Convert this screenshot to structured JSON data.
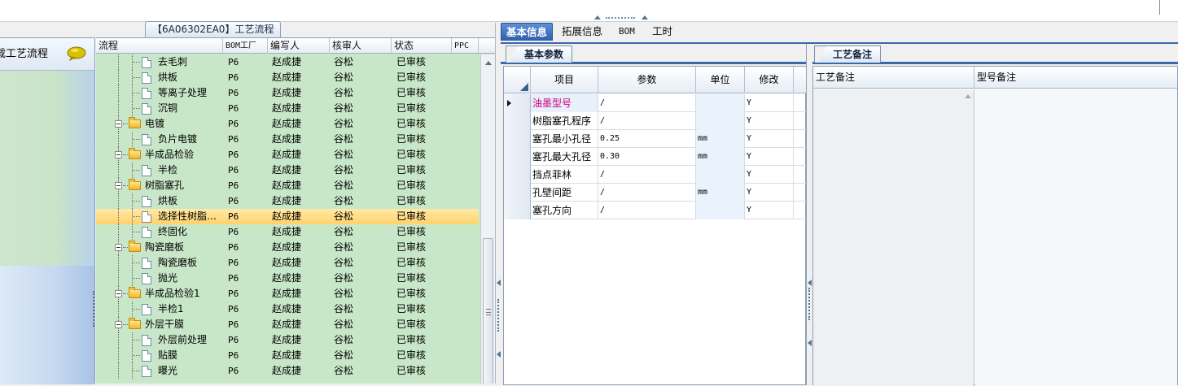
{
  "process_tab_label": "【6A06302EA0】工艺流程",
  "left_panel": {
    "load_label": "载工艺流程"
  },
  "tree": {
    "columns": [
      "流程",
      "BOM工厂",
      "编写人",
      "核审人",
      "状态",
      "PPC"
    ],
    "rows": [
      {
        "type": "leaf",
        "depth": 1,
        "name": "去毛刺",
        "bom": "P6",
        "writer": "赵成捷",
        "auditor": "谷松",
        "status": "已审核"
      },
      {
        "type": "leaf",
        "depth": 1,
        "name": "烘板",
        "bom": "P6",
        "writer": "赵成捷",
        "auditor": "谷松",
        "status": "已审核"
      },
      {
        "type": "leaf",
        "depth": 1,
        "name": "等离子处理",
        "bom": "P6",
        "writer": "赵成捷",
        "auditor": "谷松",
        "status": "已审核"
      },
      {
        "type": "leaf",
        "depth": 1,
        "name": "沉铜",
        "bom": "P6",
        "writer": "赵成捷",
        "auditor": "谷松",
        "status": "已审核"
      },
      {
        "type": "folder",
        "depth": 0,
        "name": "电镀",
        "bom": "P6",
        "writer": "赵成捷",
        "auditor": "谷松",
        "status": "已审核"
      },
      {
        "type": "leaf",
        "depth": 1,
        "name": "负片电镀",
        "bom": "P6",
        "writer": "赵成捷",
        "auditor": "谷松",
        "status": "已审核"
      },
      {
        "type": "folder",
        "depth": 0,
        "name": "半成品检验",
        "bom": "P6",
        "writer": "赵成捷",
        "auditor": "谷松",
        "status": "已审核"
      },
      {
        "type": "leaf",
        "depth": 1,
        "name": "半检",
        "bom": "P6",
        "writer": "赵成捷",
        "auditor": "谷松",
        "status": "已审核"
      },
      {
        "type": "folder",
        "depth": 0,
        "name": "树脂塞孔",
        "bom": "P6",
        "writer": "赵成捷",
        "auditor": "谷松",
        "status": "已审核"
      },
      {
        "type": "leaf",
        "depth": 1,
        "name": "烘板",
        "bom": "P6",
        "writer": "赵成捷",
        "auditor": "谷松",
        "status": "已审核"
      },
      {
        "type": "leaf",
        "depth": 1,
        "name": "选择性树脂…",
        "bom": "P6",
        "writer": "赵成捷",
        "auditor": "谷松",
        "status": "已审核",
        "selected": true
      },
      {
        "type": "leaf",
        "depth": 1,
        "name": "终固化",
        "bom": "P6",
        "writer": "赵成捷",
        "auditor": "谷松",
        "status": "已审核"
      },
      {
        "type": "folder",
        "depth": 0,
        "name": "陶瓷磨板",
        "bom": "P6",
        "writer": "赵成捷",
        "auditor": "谷松",
        "status": "已审核"
      },
      {
        "type": "leaf",
        "depth": 1,
        "name": "陶瓷磨板",
        "bom": "P6",
        "writer": "赵成捷",
        "auditor": "谷松",
        "status": "已审核"
      },
      {
        "type": "leaf",
        "depth": 1,
        "name": "抛光",
        "bom": "P6",
        "writer": "赵成捷",
        "auditor": "谷松",
        "status": "已审核"
      },
      {
        "type": "folder",
        "depth": 0,
        "name": "半成品检验1",
        "bom": "P6",
        "writer": "赵成捷",
        "auditor": "谷松",
        "status": "已审核"
      },
      {
        "type": "leaf",
        "depth": 1,
        "name": "半检1",
        "bom": "P6",
        "writer": "赵成捷",
        "auditor": "谷松",
        "status": "已审核"
      },
      {
        "type": "folder",
        "depth": 0,
        "name": "外层干膜",
        "bom": "P6",
        "writer": "赵成捷",
        "auditor": "谷松",
        "status": "已审核"
      },
      {
        "type": "leaf",
        "depth": 1,
        "name": "外层前处理",
        "bom": "P6",
        "writer": "赵成捷",
        "auditor": "谷松",
        "status": "已审核"
      },
      {
        "type": "leaf",
        "depth": 1,
        "name": "贴膜",
        "bom": "P6",
        "writer": "赵成捷",
        "auditor": "谷松",
        "status": "已审核"
      },
      {
        "type": "leaf",
        "depth": 1,
        "name": "曝光",
        "bom": "P6",
        "writer": "赵成捷",
        "auditor": "谷松",
        "status": "已审核"
      }
    ]
  },
  "right_tabs": [
    "基本信息",
    "拓展信息",
    "BOM",
    "工时"
  ],
  "basic_params": {
    "tab_label": "基本参数",
    "columns": [
      "项目",
      "参数",
      "单位",
      "修改"
    ],
    "rows": [
      {
        "item": "油墨型号",
        "param": "/",
        "unit": "",
        "modify": "Y",
        "current": true
      },
      {
        "item": "树脂塞孔程序",
        "param": "/",
        "unit": "",
        "modify": "Y"
      },
      {
        "item": "塞孔最小孔径",
        "param": "0.25",
        "unit": "mm",
        "modify": "Y"
      },
      {
        "item": "塞孔最大孔径",
        "param": "0.30",
        "unit": "mm",
        "modify": "Y"
      },
      {
        "item": "挡点菲林",
        "param": "/",
        "unit": "",
        "modify": "Y"
      },
      {
        "item": "孔壁间距",
        "param": "/",
        "unit": "mm",
        "modify": "Y"
      },
      {
        "item": "塞孔方向",
        "param": "/",
        "unit": "",
        "modify": "Y"
      }
    ]
  },
  "process_remarks": {
    "tab_label": "工艺备注",
    "columns": [
      "工艺备注",
      "型号备注"
    ]
  },
  "colors": {
    "tree_bg": "#c8e7c8",
    "selected_row": "#ffd26a",
    "active_tab": "#2f5fae",
    "highlight_text": "#d0007a"
  }
}
